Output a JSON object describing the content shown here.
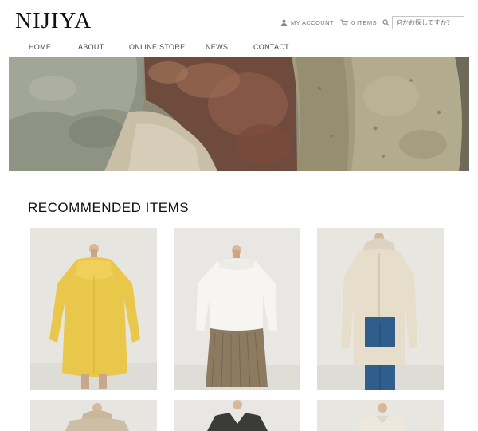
{
  "brand": {
    "name": "NIJIYA"
  },
  "header": {
    "account_label": "MY ACCOUNT",
    "cart_label": "0 ITEMS",
    "search_placeholder": "何かお探しですか？"
  },
  "nav": {
    "items": [
      {
        "label": "HOME"
      },
      {
        "label": "ABOUT"
      },
      {
        "label": "ONLINE STORE"
      },
      {
        "label": "NEWS"
      },
      {
        "label": "CONTACT"
      }
    ]
  },
  "hero": {
    "icon": "rocks-and-tidepool-photo"
  },
  "recommended": {
    "title": "RECOMMENDED ITEMS",
    "products": [
      {
        "icon": "yellow-dress-photo",
        "color": "#e8c74a"
      },
      {
        "icon": "white-blouse-and-skirt-photo",
        "color": "#f3f1ec"
      },
      {
        "icon": "beige-hooded-coat-photo",
        "color": "#e4dccd"
      },
      {
        "icon": "beige-hooded-jacket-photo",
        "color": "#cdbfa9"
      },
      {
        "icon": "charcoal-blouse-photo",
        "color": "#3a3a38"
      },
      {
        "icon": "cream-blouse-photo",
        "color": "#ece6da"
      }
    ]
  }
}
